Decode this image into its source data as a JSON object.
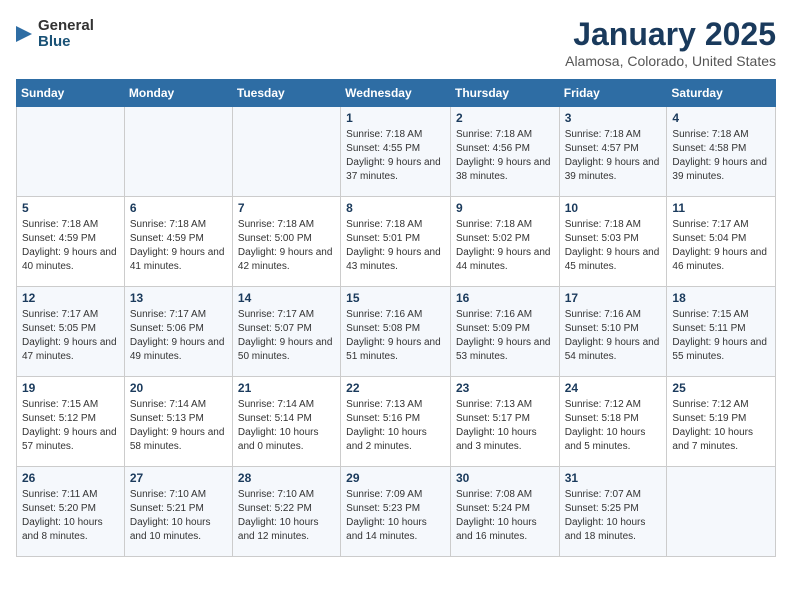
{
  "header": {
    "logo_general": "General",
    "logo_blue": "Blue",
    "title": "January 2025",
    "subtitle": "Alamosa, Colorado, United States"
  },
  "columns": [
    "Sunday",
    "Monday",
    "Tuesday",
    "Wednesday",
    "Thursday",
    "Friday",
    "Saturday"
  ],
  "weeks": [
    {
      "days": [
        {
          "num": "",
          "info": ""
        },
        {
          "num": "",
          "info": ""
        },
        {
          "num": "",
          "info": ""
        },
        {
          "num": "1",
          "info": "Sunrise: 7:18 AM\nSunset: 4:55 PM\nDaylight: 9 hours and 37 minutes."
        },
        {
          "num": "2",
          "info": "Sunrise: 7:18 AM\nSunset: 4:56 PM\nDaylight: 9 hours and 38 minutes."
        },
        {
          "num": "3",
          "info": "Sunrise: 7:18 AM\nSunset: 4:57 PM\nDaylight: 9 hours and 39 minutes."
        },
        {
          "num": "4",
          "info": "Sunrise: 7:18 AM\nSunset: 4:58 PM\nDaylight: 9 hours and 39 minutes."
        }
      ]
    },
    {
      "days": [
        {
          "num": "5",
          "info": "Sunrise: 7:18 AM\nSunset: 4:59 PM\nDaylight: 9 hours and 40 minutes."
        },
        {
          "num": "6",
          "info": "Sunrise: 7:18 AM\nSunset: 4:59 PM\nDaylight: 9 hours and 41 minutes."
        },
        {
          "num": "7",
          "info": "Sunrise: 7:18 AM\nSunset: 5:00 PM\nDaylight: 9 hours and 42 minutes."
        },
        {
          "num": "8",
          "info": "Sunrise: 7:18 AM\nSunset: 5:01 PM\nDaylight: 9 hours and 43 minutes."
        },
        {
          "num": "9",
          "info": "Sunrise: 7:18 AM\nSunset: 5:02 PM\nDaylight: 9 hours and 44 minutes."
        },
        {
          "num": "10",
          "info": "Sunrise: 7:18 AM\nSunset: 5:03 PM\nDaylight: 9 hours and 45 minutes."
        },
        {
          "num": "11",
          "info": "Sunrise: 7:17 AM\nSunset: 5:04 PM\nDaylight: 9 hours and 46 minutes."
        }
      ]
    },
    {
      "days": [
        {
          "num": "12",
          "info": "Sunrise: 7:17 AM\nSunset: 5:05 PM\nDaylight: 9 hours and 47 minutes."
        },
        {
          "num": "13",
          "info": "Sunrise: 7:17 AM\nSunset: 5:06 PM\nDaylight: 9 hours and 49 minutes."
        },
        {
          "num": "14",
          "info": "Sunrise: 7:17 AM\nSunset: 5:07 PM\nDaylight: 9 hours and 50 minutes."
        },
        {
          "num": "15",
          "info": "Sunrise: 7:16 AM\nSunset: 5:08 PM\nDaylight: 9 hours and 51 minutes."
        },
        {
          "num": "16",
          "info": "Sunrise: 7:16 AM\nSunset: 5:09 PM\nDaylight: 9 hours and 53 minutes."
        },
        {
          "num": "17",
          "info": "Sunrise: 7:16 AM\nSunset: 5:10 PM\nDaylight: 9 hours and 54 minutes."
        },
        {
          "num": "18",
          "info": "Sunrise: 7:15 AM\nSunset: 5:11 PM\nDaylight: 9 hours and 55 minutes."
        }
      ]
    },
    {
      "days": [
        {
          "num": "19",
          "info": "Sunrise: 7:15 AM\nSunset: 5:12 PM\nDaylight: 9 hours and 57 minutes."
        },
        {
          "num": "20",
          "info": "Sunrise: 7:14 AM\nSunset: 5:13 PM\nDaylight: 9 hours and 58 minutes."
        },
        {
          "num": "21",
          "info": "Sunrise: 7:14 AM\nSunset: 5:14 PM\nDaylight: 10 hours and 0 minutes."
        },
        {
          "num": "22",
          "info": "Sunrise: 7:13 AM\nSunset: 5:16 PM\nDaylight: 10 hours and 2 minutes."
        },
        {
          "num": "23",
          "info": "Sunrise: 7:13 AM\nSunset: 5:17 PM\nDaylight: 10 hours and 3 minutes."
        },
        {
          "num": "24",
          "info": "Sunrise: 7:12 AM\nSunset: 5:18 PM\nDaylight: 10 hours and 5 minutes."
        },
        {
          "num": "25",
          "info": "Sunrise: 7:12 AM\nSunset: 5:19 PM\nDaylight: 10 hours and 7 minutes."
        }
      ]
    },
    {
      "days": [
        {
          "num": "26",
          "info": "Sunrise: 7:11 AM\nSunset: 5:20 PM\nDaylight: 10 hours and 8 minutes."
        },
        {
          "num": "27",
          "info": "Sunrise: 7:10 AM\nSunset: 5:21 PM\nDaylight: 10 hours and 10 minutes."
        },
        {
          "num": "28",
          "info": "Sunrise: 7:10 AM\nSunset: 5:22 PM\nDaylight: 10 hours and 12 minutes."
        },
        {
          "num": "29",
          "info": "Sunrise: 7:09 AM\nSunset: 5:23 PM\nDaylight: 10 hours and 14 minutes."
        },
        {
          "num": "30",
          "info": "Sunrise: 7:08 AM\nSunset: 5:24 PM\nDaylight: 10 hours and 16 minutes."
        },
        {
          "num": "31",
          "info": "Sunrise: 7:07 AM\nSunset: 5:25 PM\nDaylight: 10 hours and 18 minutes."
        },
        {
          "num": "",
          "info": ""
        }
      ]
    }
  ]
}
